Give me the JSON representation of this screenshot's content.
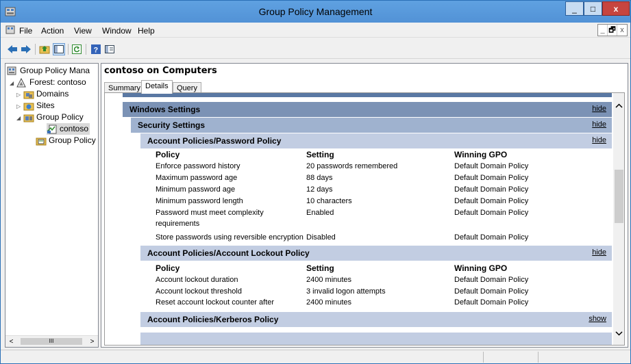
{
  "window": {
    "title": "Group Policy Management",
    "minimize_glyph": "_",
    "maximize_glyph": "□",
    "close_glyph": "x"
  },
  "menu": {
    "items": [
      "File",
      "Action",
      "View",
      "Window",
      "Help"
    ],
    "mdi_buttons": [
      "_",
      "🗗",
      "x"
    ]
  },
  "toolbar": {
    "icons": [
      "back-arrow-icon",
      "forward-arrow-icon",
      "up-folder-icon",
      "show-hide-tree-icon",
      "refresh-icon",
      "help-icon",
      "properties-icon"
    ]
  },
  "tree": {
    "items": [
      {
        "label": "Group Policy Mana",
        "indent": 0,
        "expander": "",
        "icon": "gpm-console-icon"
      },
      {
        "label": "Forest: contoso",
        "indent": 1,
        "expander": "◢",
        "icon": "forest-icon"
      },
      {
        "label": "Domains",
        "indent": 2,
        "expander": "▷",
        "icon": "domains-folder-icon"
      },
      {
        "label": "Sites",
        "indent": 2,
        "expander": "▷",
        "icon": "sites-folder-icon"
      },
      {
        "label": "Group Policy",
        "indent": 2,
        "expander": "◢",
        "icon": "gp-modeling-icon"
      },
      {
        "label": "contoso",
        "indent": 3,
        "expander": "",
        "icon": "rsop-result-icon",
        "selected": true
      },
      {
        "label": "Group Policy",
        "indent": 2,
        "expander": "",
        "icon": "gp-results-icon"
      }
    ],
    "hscroll_thumb": "III"
  },
  "right_pane": {
    "title": "contoso on Computers",
    "tabs": [
      "Summary",
      "Details",
      "Query"
    ],
    "active_tab": "Details"
  },
  "report": {
    "hide_label": "hide",
    "show_label": "show",
    "windows_settings": "Windows Settings",
    "security_settings": "Security Settings",
    "columns": {
      "policy": "Policy",
      "setting": "Setting",
      "winning": "Winning GPO"
    },
    "password_policy": {
      "title": "Account Policies/Password Policy",
      "rows": [
        {
          "policy": "Enforce password history",
          "setting": "20 passwords remembered",
          "gpo": "Default Domain Policy"
        },
        {
          "policy": "Maximum password age",
          "setting": "88 days",
          "gpo": "Default Domain Policy"
        },
        {
          "policy": "Minimum password age",
          "setting": "12 days",
          "gpo": "Default Domain Policy"
        },
        {
          "policy": "Minimum password length",
          "setting": "10 characters",
          "gpo": "Default Domain Policy"
        },
        {
          "policy": "Password must meet complexity",
          "policy2": "requirements",
          "setting": "Enabled",
          "gpo": "Default Domain Policy"
        },
        {
          "policy": "Store passwords using reversible encryption",
          "setting": "Disabled",
          "gpo": "Default Domain Policy"
        }
      ]
    },
    "lockout_policy": {
      "title": "Account Policies/Account Lockout Policy",
      "rows": [
        {
          "policy": "Account lockout duration",
          "setting": "2400 minutes",
          "gpo": "Default Domain Policy"
        },
        {
          "policy": "Account lockout threshold",
          "setting": "3 invalid logon attempts",
          "gpo": "Default Domain Policy"
        },
        {
          "policy": "Reset account lockout counter after",
          "setting": "2400 minutes",
          "gpo": "Default Domain Policy"
        }
      ]
    },
    "kerberos_policy": {
      "title": "Account Policies/Kerberos Policy"
    }
  }
}
